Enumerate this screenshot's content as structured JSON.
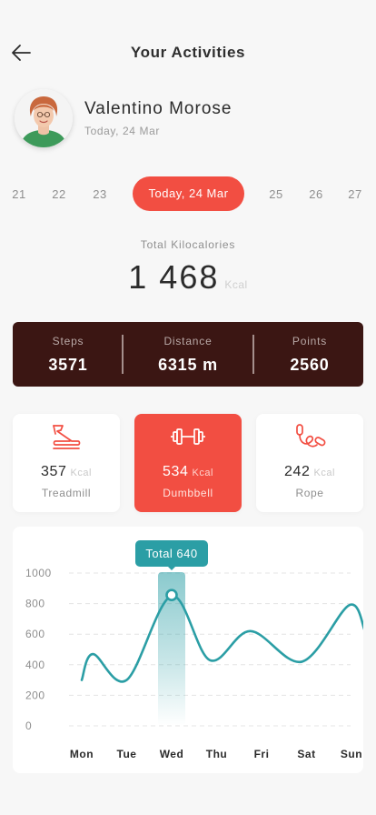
{
  "header": {
    "title": "Your Activities",
    "back_icon": "arrow-left-icon"
  },
  "profile": {
    "name": "Valentino Morose",
    "date": "Today, 24 Mar"
  },
  "dates": {
    "before": [
      "21",
      "22",
      "23"
    ],
    "active": "Today, 24 Mar",
    "after": [
      "25",
      "26",
      "27"
    ]
  },
  "summary": {
    "label": "Total Kilocalories",
    "value": "1 468",
    "unit": "Kcal"
  },
  "stats": [
    {
      "label": "Steps",
      "value": "3571"
    },
    {
      "label": "Distance",
      "value": "6315 m"
    },
    {
      "label": "Points",
      "value": "2560"
    }
  ],
  "activities": [
    {
      "value": "357",
      "unit": "Kcal",
      "name": "Treadmill",
      "icon": "treadmill-icon",
      "active": false
    },
    {
      "value": "534",
      "unit": "Kcal",
      "name": "Dumbbell",
      "icon": "dumbbell-icon",
      "active": true
    },
    {
      "value": "242",
      "unit": "Kcal",
      "name": "Rope",
      "icon": "jump-rope-icon",
      "active": false
    }
  ],
  "colors": {
    "accent": "#f24e42",
    "dark": "#3b1613",
    "teal": "#2b9ea5",
    "background": "#f7f7f7"
  },
  "chart_data": {
    "type": "line",
    "tooltip": "Total 640",
    "categories": [
      "Mon",
      "Tue",
      "Wed",
      "Thu",
      "Fri",
      "Sat",
      "Sun"
    ],
    "yticks": [
      "1000",
      "800",
      "600",
      "400",
      "200",
      "0"
    ],
    "ylim": [
      0,
      1000
    ],
    "grid": true,
    "highlight": "Wed",
    "points": [
      {
        "x": 0.0,
        "y": 300
      },
      {
        "x": 0.25,
        "y": 470
      },
      {
        "x": 1.0,
        "y": 300
      },
      {
        "x": 2.0,
        "y": 850
      },
      {
        "x": 2.85,
        "y": 430
      },
      {
        "x": 3.75,
        "y": 620
      },
      {
        "x": 4.9,
        "y": 420
      },
      {
        "x": 5.95,
        "y": 790
      },
      {
        "x": 6.3,
        "y": 620
      }
    ]
  }
}
